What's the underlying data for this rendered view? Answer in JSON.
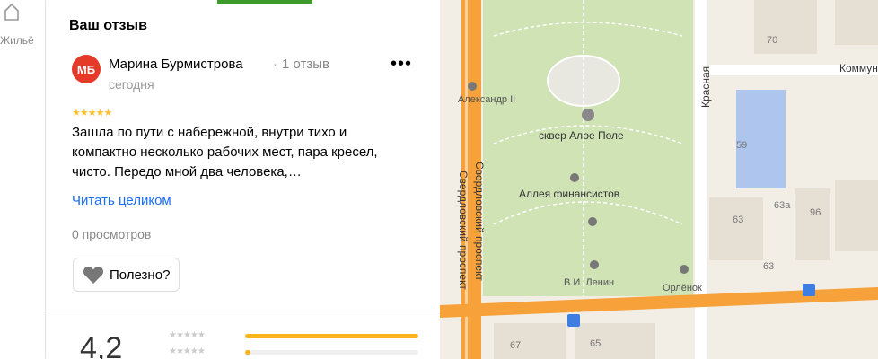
{
  "left_rail": {
    "label": "Жильё"
  },
  "review": {
    "header": "Ваш отзыв",
    "avatar_initials": "МБ",
    "author": "Марина Бурмистрова",
    "separator": "·",
    "review_count": "1 отзыв",
    "date": "сегодня",
    "stars": "★★★★★",
    "text": "Зашла по пути с набережной, внутри тихо и компактно несколько рабочих мест, пара кресел, чисто. Передо мной два человека,…",
    "read_more": "Читать целиком",
    "views": "0 просмотров",
    "useful_label": "Полезно?",
    "more_glyph": "•••"
  },
  "rating_summary": {
    "value": "4,2",
    "distribution": [
      {
        "stars": "★★★★★",
        "fill": 1.0
      },
      {
        "stars": "★★★★★",
        "fill": 0.03
      }
    ]
  },
  "map": {
    "labels": {
      "street_main": "Свердловский проспект",
      "street_red": "Красная",
      "street_kommun": "Коммун",
      "park": "сквер Алое Поле",
      "alley": "Аллея финансистов",
      "monument_1": "Александр II",
      "monument_2": "В.И. Ленин",
      "monument_3": "Орлёнок"
    },
    "house_numbers": [
      "70",
      "59",
      "63",
      "63а",
      "96",
      "63",
      "67",
      "65"
    ],
    "colors": {
      "road": "#f6a13a",
      "park": "#cfe3b5",
      "land": "#f2eee6",
      "building": "#e5e0d3",
      "water_school": "#aec6ee"
    }
  }
}
